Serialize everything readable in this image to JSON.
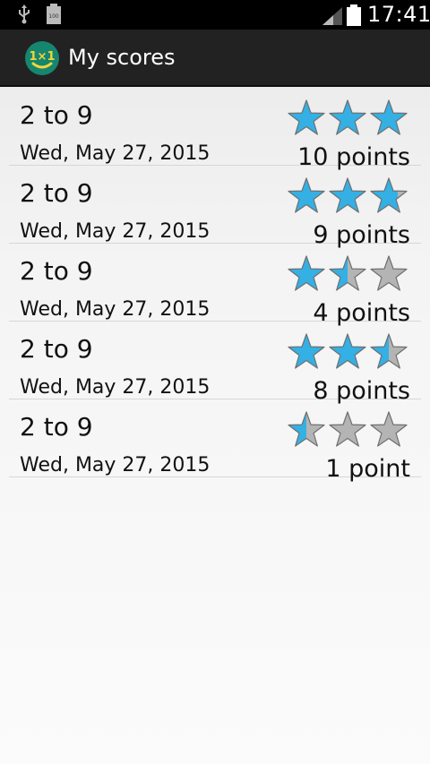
{
  "status_bar": {
    "time": "17:41",
    "icons": [
      "usb-icon",
      "battery-indicator-icon",
      "signal-icon",
      "battery-icon"
    ],
    "battery_label": "100"
  },
  "action_bar": {
    "title": "My scores",
    "app_icon": "1×1"
  },
  "colors": {
    "star_filled": "#34b0e5",
    "star_empty": "#b4b4b4",
    "action_bar": "#222222"
  },
  "scores": [
    {
      "range": "2 to 9",
      "date": "Wed, May 27, 2015",
      "points": "10 points",
      "stars": 3
    },
    {
      "range": "2 to 9",
      "date": "Wed, May 27, 2015",
      "points": "9 points",
      "stars": 2.75
    },
    {
      "range": "2 to 9",
      "date": "Wed, May 27, 2015",
      "points": "4 points",
      "stars": 1.5
    },
    {
      "range": "2 to 9",
      "date": "Wed, May 27, 2015",
      "points": "8 points",
      "stars": 2.5
    },
    {
      "range": "2 to 9",
      "date": "Wed, May 27, 2015",
      "points": "1 point",
      "stars": 0.5
    }
  ]
}
